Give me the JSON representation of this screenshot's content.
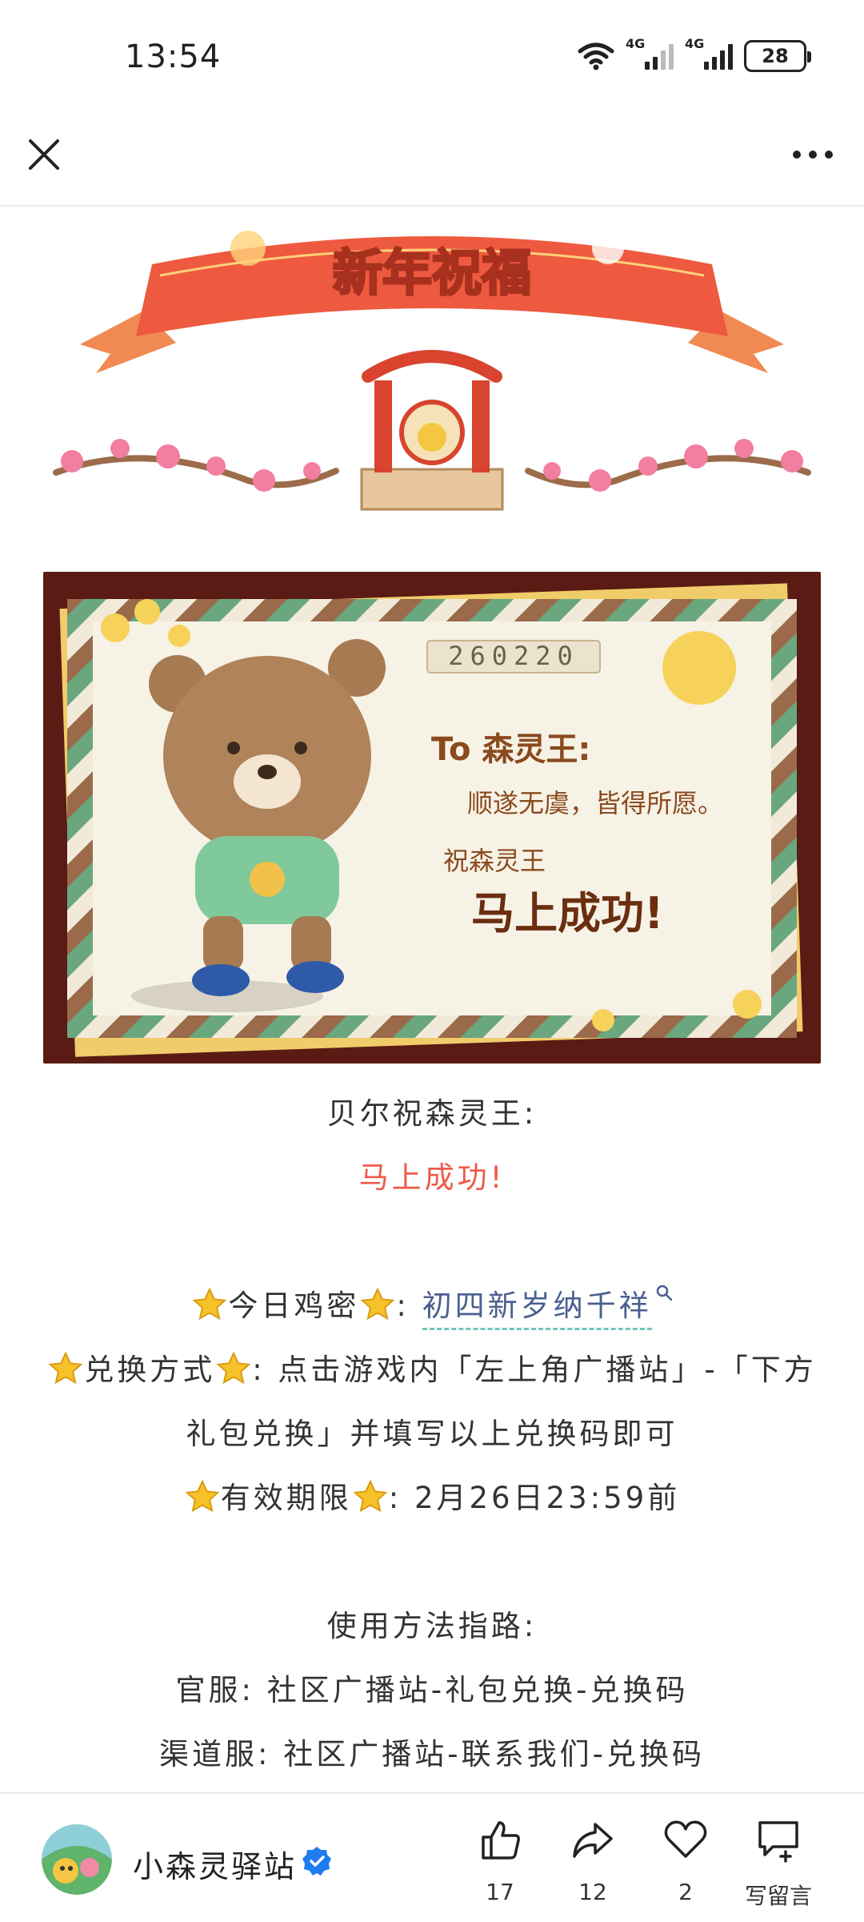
{
  "status_bar": {
    "time": "13:54",
    "network_1": "4G",
    "network_2": "4G",
    "battery": "28"
  },
  "nav": {
    "close_icon": "close-icon",
    "more_icon": "more-icon"
  },
  "banner": {
    "title": "新年祝福"
  },
  "card": {
    "date": "260220",
    "to_line": "To 森灵王:",
    "wish_line": "顺遂无虞，皆得所愿。",
    "bless_line": "祝森灵王",
    "success_line": "马上成功!"
  },
  "content": {
    "greeting": "贝尔祝森灵王:",
    "greeting_red": "马上成功!",
    "code_label": "今日鸡密",
    "code_sep": ":",
    "code_value": "初四新岁纳千祥",
    "method_label": "兑换方式",
    "method_text_1": ": 点击游戏内「左上角广播站」-「下方",
    "method_text_2": "礼包兑换」并填写以上兑换码即可",
    "expiry_label": "有效期限",
    "expiry_text": ": 2月26日23:59前",
    "guide_title": "使用方法指路:",
    "guide_official": "官服: 社区广播站-礼包兑换-兑换码",
    "guide_channel": "渠道服: 社区广播站-联系我们-兑换码"
  },
  "bottom_bar": {
    "account_name": "小森灵驿站",
    "like_count": "17",
    "share_count": "12",
    "heart_count": "2",
    "comment_label": "写留言"
  },
  "colors": {
    "accent_red": "#ec5b4a",
    "link_blue": "#4a5f8f",
    "link_underline": "#6fc7b8",
    "verified_blue": "#1e7cf0"
  }
}
